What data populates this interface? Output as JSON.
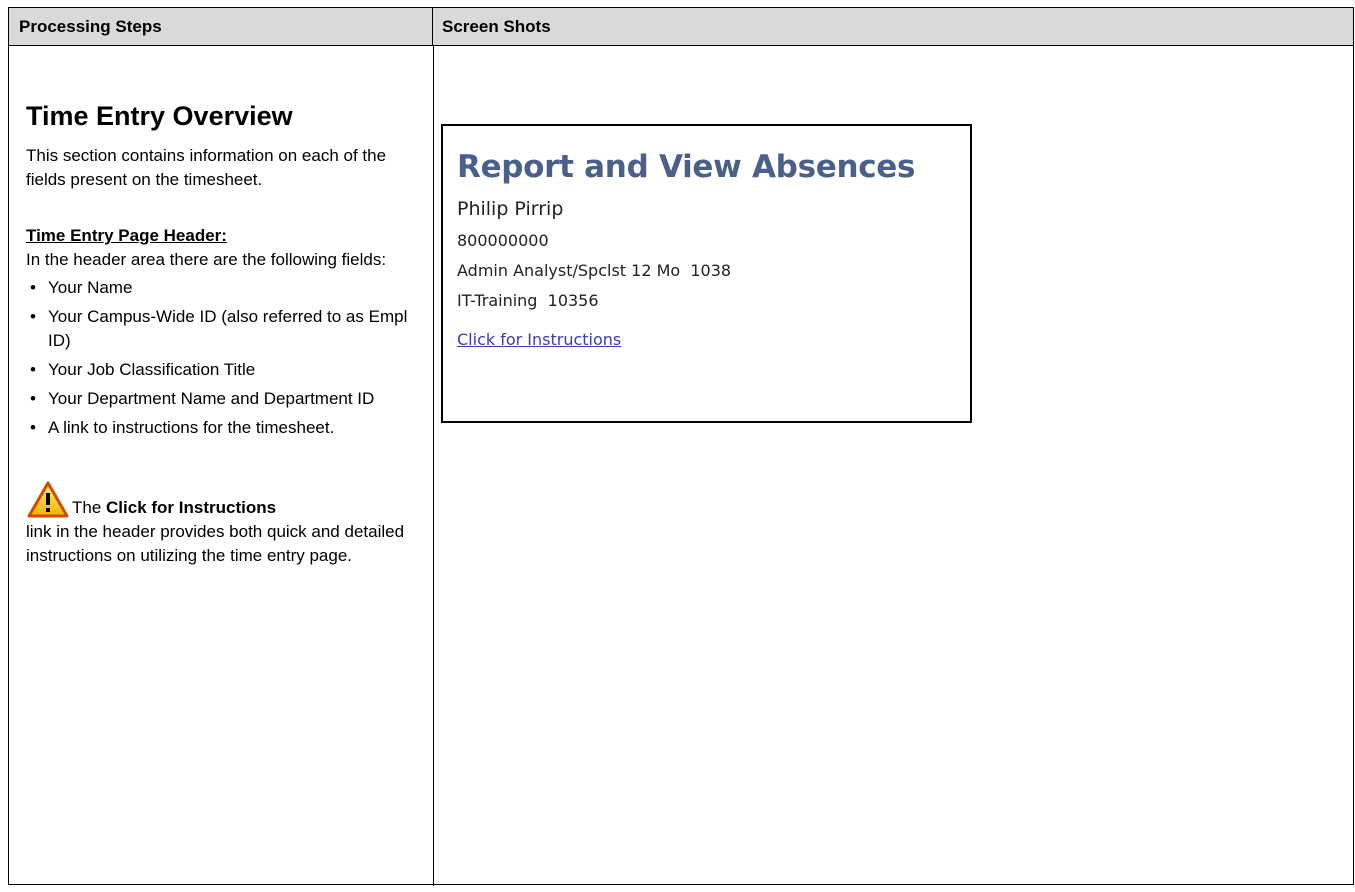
{
  "table": {
    "header_left": "Processing Steps",
    "header_right": "Screen Shots"
  },
  "left": {
    "title": "Time Entry Overview",
    "intro": "This section contains information on each of the fields present on the timesheet.",
    "subheading": "Time Entry Page Header:",
    "subtext": "In the header area there are the following fields:",
    "bullets": [
      "Your Name",
      "Your Campus-Wide ID (also referred to as Empl ID)",
      "Your Job Classification Title",
      "Your Department Name and Department ID",
      "A link to instructions for the timesheet."
    ],
    "note_prefix": "The",
    "note_bold": "Click for Instructions",
    "note_rest": "link in the header provides both quick and detailed instructions on utilizing the time entry page.",
    "note_icon": "warning-icon"
  },
  "screenshot": {
    "title": "Report and View Absences",
    "name": "Philip Pirrip",
    "empl_id": "800000000",
    "job": "Admin Analyst/Spclst 12 Mo  1038",
    "dept": "IT-Training  10356",
    "link": "Click for Instructions",
    "title_color": "#4a5f8a",
    "link_color": "#3c3cb4"
  }
}
